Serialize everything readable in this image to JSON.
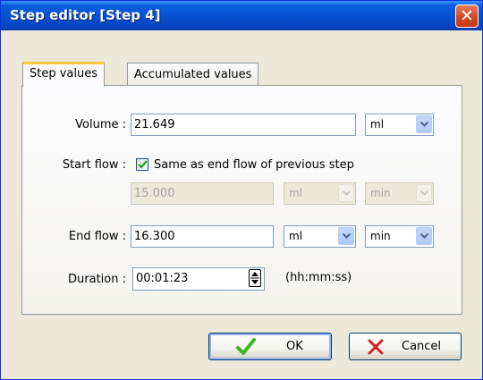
{
  "window": {
    "title": "Step editor [Step 4]",
    "close_glyph": "✕",
    "titlebar_color": "#0852d4",
    "close_color": "#d5451f"
  },
  "tabs": [
    {
      "label": "Step values",
      "active": true
    },
    {
      "label": "Accumulated values",
      "active": false
    }
  ],
  "form": {
    "volume": {
      "label": "Volume :",
      "value": "21.649",
      "unit": "ml"
    },
    "start_flow": {
      "label": "Start flow :",
      "checkbox_label": "Same as end flow of previous step",
      "checked": true,
      "value": "15.000",
      "unit": "ml",
      "time_unit": "min"
    },
    "end_flow": {
      "label": "End flow :",
      "value": "16.300",
      "unit": "ml",
      "time_unit": "min"
    },
    "duration": {
      "label": "Duration :",
      "value": "00:01:23",
      "format_hint": "(hh:mm:ss)"
    }
  },
  "buttons": {
    "ok": {
      "label": "OK",
      "icon": "check-icon",
      "icon_color": "#3cb81c"
    },
    "cancel": {
      "label": "Cancel",
      "icon": "x-icon",
      "icon_color": "#d81e1e"
    }
  }
}
